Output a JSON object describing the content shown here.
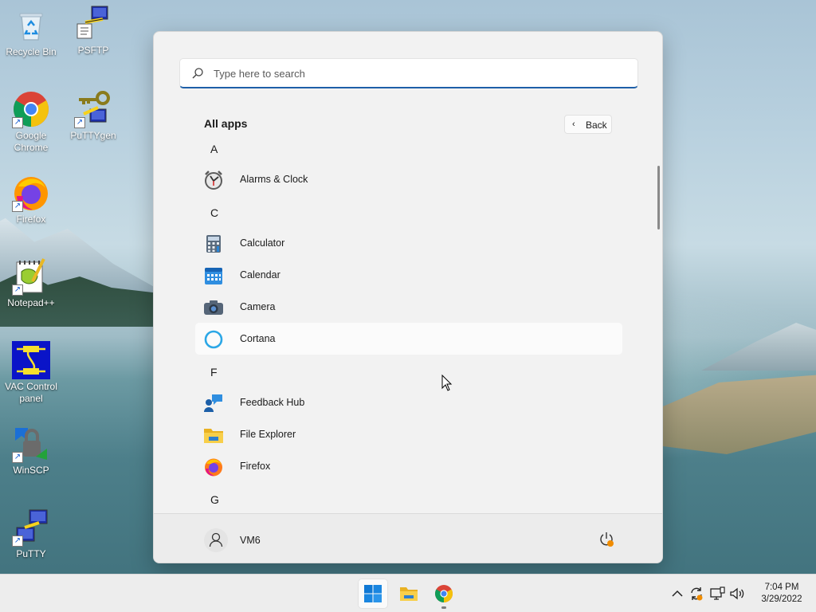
{
  "desktop": {
    "icons": [
      {
        "label": "Recycle Bin"
      },
      {
        "label": "PSFTP"
      },
      {
        "label": "Google Chrome"
      },
      {
        "label": "PuTTYgen"
      },
      {
        "label": "Firefox"
      },
      {
        "label": "Notepad++"
      },
      {
        "label": "VAC Control panel"
      },
      {
        "label": "WinSCP"
      },
      {
        "label": "PuTTY"
      }
    ]
  },
  "start_menu": {
    "search_placeholder": "Type here to search",
    "title": "All apps",
    "back_label": "Back",
    "sections": [
      {
        "letter": "A",
        "apps": [
          {
            "label": "Alarms & Clock",
            "icon": "alarm-clock-icon"
          }
        ]
      },
      {
        "letter": "C",
        "apps": [
          {
            "label": "Calculator",
            "icon": "calculator-icon"
          },
          {
            "label": "Calendar",
            "icon": "calendar-icon"
          },
          {
            "label": "Camera",
            "icon": "camera-icon"
          },
          {
            "label": "Cortana",
            "icon": "cortana-icon",
            "highlighted": true
          }
        ]
      },
      {
        "letter": "F",
        "apps": [
          {
            "label": "Feedback Hub",
            "icon": "feedback-hub-icon"
          },
          {
            "label": "File Explorer",
            "icon": "folder-icon"
          },
          {
            "label": "Firefox",
            "icon": "firefox-icon"
          }
        ]
      },
      {
        "letter": "G",
        "apps": []
      }
    ],
    "user_name": "VM6"
  },
  "taskbar": {
    "time": "7:04 PM",
    "date": "3/29/2022"
  },
  "colors": {
    "accent": "#1e5fa8",
    "windows_blue": "#0f78d4",
    "taskbar_bg": "#ededed",
    "menu_bg": "#f2f2f2"
  }
}
